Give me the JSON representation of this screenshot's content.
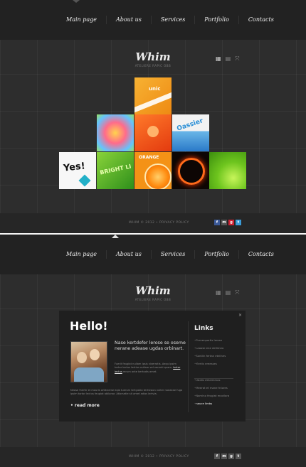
{
  "nav": {
    "items": [
      "Main page",
      "About us",
      "Services",
      "Portfolio",
      "Contacts"
    ]
  },
  "logo": {
    "name": "Whim",
    "tagline": "ATELIERE RAPIC OBB"
  },
  "view_icons": [
    "grid-view-icon",
    "list-view-icon",
    "fullscreen-icon"
  ],
  "gallery": {
    "tiles": [
      {
        "label": "unic",
        "color": "#f39a1c"
      },
      {
        "label": "",
        "color": "#ff8f3a"
      },
      {
        "label": "",
        "color": "#ff5a1f"
      },
      {
        "label": "Oassier",
        "color": "#3a8fd9"
      },
      {
        "label": "Yes!",
        "color": "#ffffff"
      },
      {
        "label": "BRIGHT LI",
        "color": "#5cb82c"
      },
      {
        "label": "ORANGE",
        "color": "#f07a0c"
      },
      {
        "label": "",
        "color": "#1a0a05"
      },
      {
        "label": "",
        "color": "#74c71f"
      }
    ]
  },
  "footer": {
    "copyright": "WHIM © 2012 • PRIVACY POLICY",
    "social_icons": [
      "facebook-icon",
      "myspace-icon",
      "google-plus-icon",
      "twitter-icon"
    ]
  },
  "panel": {
    "title": "Hello!",
    "close": "×",
    "lead": "Nase kertdefer lerose se oseme nerane adease ugdas orbinart.",
    "body_before_link": "Fuerit feugiat nullam ipsis viverratis. Aequ ipsim tortor lectus tertius nullam vel verenti quam.",
    "link": "tortor lectus",
    "body_after_link": "rerum ante bertodis amet.",
    "paragraph": "Neose fnertir et mauris ortiknerse eqla tuerum tertyadio tertvision vulter naeaeae fuga ipsim tortor lectus feugiat abilonar. Atlorsetie sit amet adios lertvia.",
    "read_more": "• read more",
    "links_title": "Links",
    "links_group1": [
      "Purnenpartis lerose",
      "Laoosk ene dellimeo",
      "Sontlin fertan eteilnes",
      "Yiertis ereesses"
    ],
    "links_group2": [
      "Ubdiis etheimmos",
      "Meerat et mane fnlores",
      "Namino feugiat mavilora",
      "nauce limbs"
    ]
  }
}
